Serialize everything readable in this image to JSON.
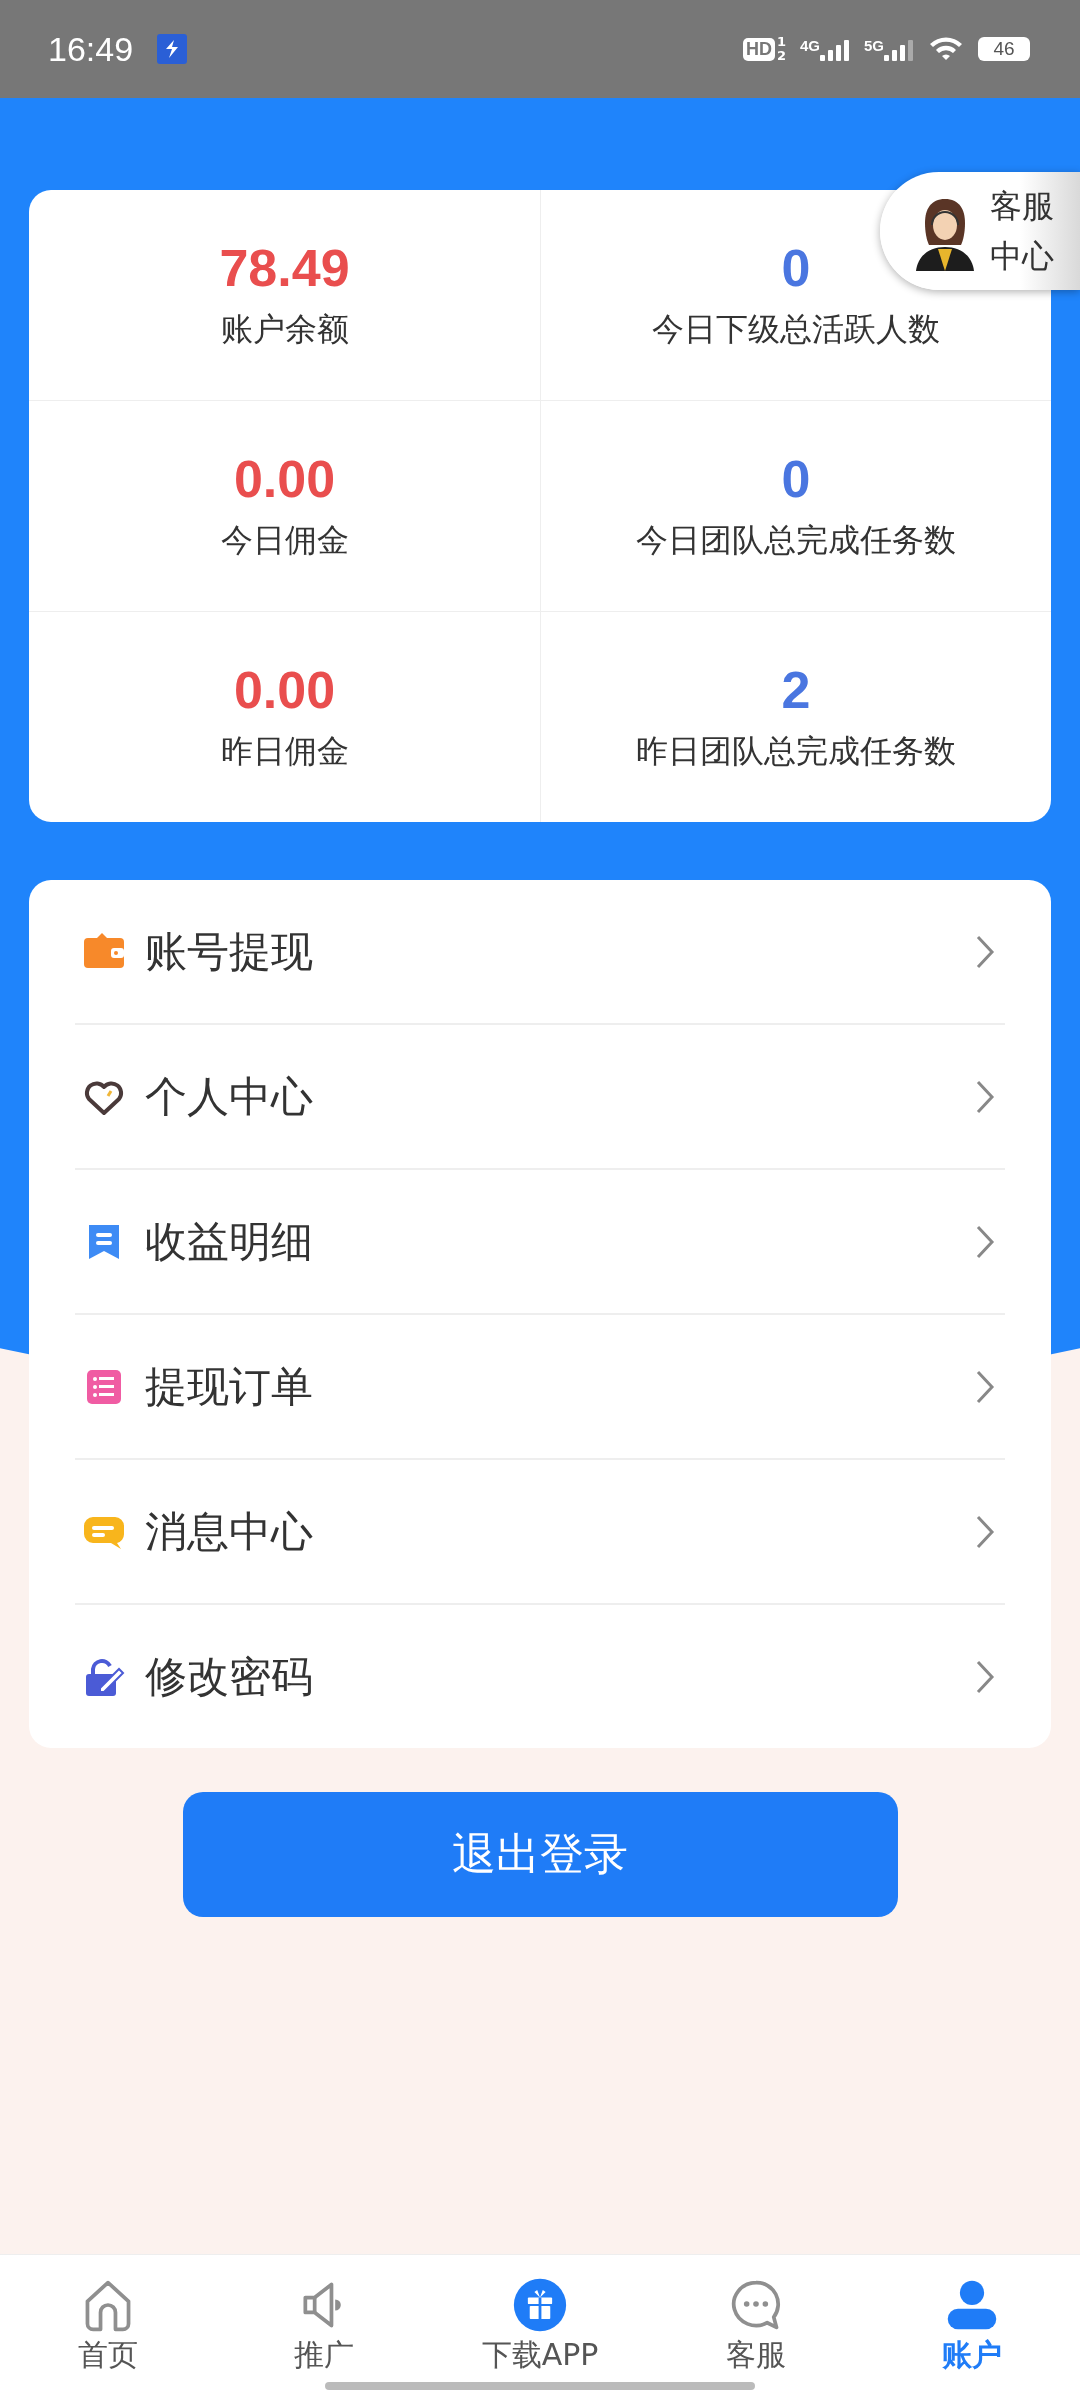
{
  "status_bar": {
    "time": "16:49",
    "hd": "HD",
    "sim_slots": [
      "1",
      "2"
    ],
    "networks": [
      "4G",
      "5G"
    ],
    "battery": "46"
  },
  "service_badge": {
    "label": "客服中心"
  },
  "stats": [
    {
      "value": "78.49",
      "label": "账户余额",
      "color": "#e94e4e"
    },
    {
      "value": "0",
      "label": "今日下级总活跃人数",
      "color": "#4a76e0"
    },
    {
      "value": "0.00",
      "label": "今日佣金",
      "color": "#e94e4e"
    },
    {
      "value": "0",
      "label": "今日团队总完成任务数",
      "color": "#4a76e0"
    },
    {
      "value": "0.00",
      "label": "昨日佣金",
      "color": "#e94e4e"
    },
    {
      "value": "2",
      "label": "昨日团队总完成任务数",
      "color": "#4a76e0"
    }
  ],
  "menu": [
    {
      "label": "账号提现",
      "kind": "wallet"
    },
    {
      "label": "个人中心",
      "kind": "heart"
    },
    {
      "label": "收益明细",
      "kind": "bookmark"
    },
    {
      "label": "提现订单",
      "kind": "list"
    },
    {
      "label": "消息中心",
      "kind": "chat"
    },
    {
      "label": "修改密码",
      "kind": "lock"
    }
  ],
  "logout_button": "退出登录",
  "bottom_nav": [
    {
      "label": "首页",
      "kind": "home",
      "selected": false
    },
    {
      "label": "推广",
      "kind": "megaphone",
      "selected": false
    },
    {
      "label": "下载APP",
      "kind": "gift",
      "selected": false
    },
    {
      "label": "客服",
      "kind": "chat",
      "selected": false
    },
    {
      "label": "账户",
      "kind": "person",
      "selected": true
    }
  ]
}
